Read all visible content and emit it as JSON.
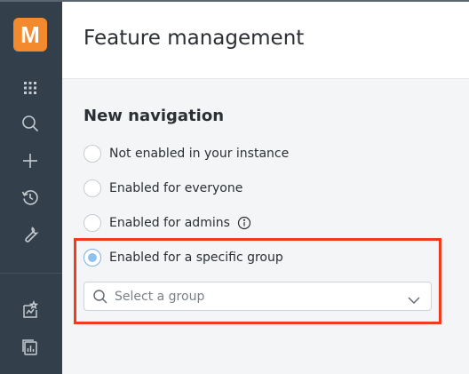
{
  "app": {
    "logo_letter": "M",
    "accent_color": "#f38a2e",
    "sidebar_color": "#33404b"
  },
  "sidebar": {
    "items": [
      {
        "icon": "apps-grid-icon"
      },
      {
        "icon": "search-icon"
      },
      {
        "icon": "add-icon"
      },
      {
        "icon": "history-icon"
      },
      {
        "icon": "wrench-icon"
      },
      {
        "icon": "whats-new-icon"
      },
      {
        "icon": "reports-icon"
      }
    ]
  },
  "header": {
    "title": "Feature management"
  },
  "section": {
    "title": "New navigation",
    "options": [
      {
        "label": "Not enabled in your instance",
        "checked": false
      },
      {
        "label": "Enabled for everyone",
        "checked": false
      },
      {
        "label": "Enabled for admins",
        "checked": false,
        "info_icon": "info-icon"
      },
      {
        "label": "Enabled for a specific group",
        "checked": true
      }
    ]
  },
  "group_select": {
    "placeholder": "Select a group",
    "value": ""
  },
  "highlight_color": "#f23a1f"
}
